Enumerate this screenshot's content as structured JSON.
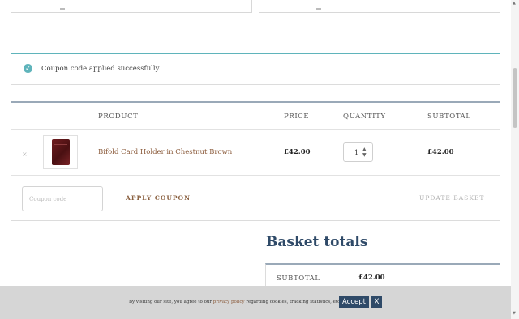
{
  "notice": {
    "message": "Coupon code applied successfully.",
    "icon": "check-circle-icon",
    "accent": "#5fb4bb"
  },
  "cart": {
    "headers": {
      "product": "PRODUCT",
      "price": "PRICE",
      "quantity": "QUANTITY",
      "subtotal": "SUBTOTAL"
    },
    "items": [
      {
        "remove": "×",
        "name": "Bifold Card Holder in Chestnut Brown",
        "price": "£42.00",
        "quantity": "1",
        "subtotal": "£42.00"
      }
    ],
    "coupon_placeholder": "Coupon code",
    "apply_label": "APPLY COUPON",
    "update_label": "UPDATE BASKET"
  },
  "totals": {
    "title": "Basket totals",
    "subtotal_label": "SUBTOTAL",
    "subtotal_value": "£42.00"
  },
  "cookie": {
    "text_before": "By visiting our site, you agree to our ",
    "link": "privacy policy",
    "text_after": " regarding cookies, tracking statistics, etc.",
    "accept_label": "Accept",
    "close_label": "X"
  },
  "colors": {
    "brand_blue": "#2f4a68",
    "link_brown": "#8a5a3a",
    "notice_teal": "#5fb4bb"
  }
}
